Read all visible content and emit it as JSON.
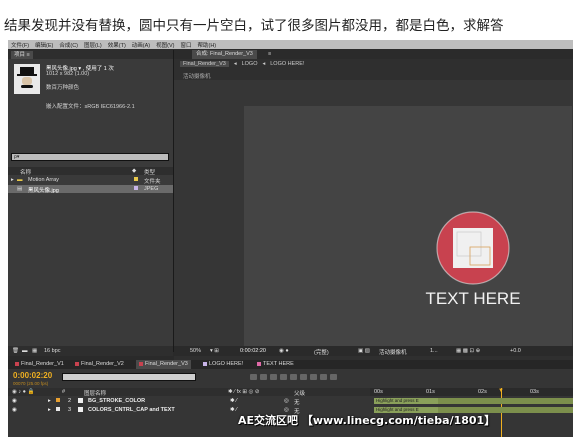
{
  "post": {
    "question": "结果发现并没有替换，圆中只有一片空白，试了很多图片都没用，都是白色，求解答"
  },
  "menubar": {
    "items": [
      "文件(F)",
      "编辑(E)",
      "合成(C)",
      "图层(L)",
      "效果(T)",
      "动画(A)",
      "视图(V)",
      "窗口",
      "帮助(H)"
    ]
  },
  "project": {
    "tab_label": "项目 ≡",
    "file_name": "黑风头像.jpg ▾ , 使用了 1 次",
    "file_size": "1012 x 982 (1.00)",
    "file_colors": "数百万种颜色",
    "color_profile": "嵌入配置文件：sRGB IEC61966-2.1",
    "search_value": "ρ▾",
    "col_name": "名称",
    "col_type": "类型",
    "rows": [
      {
        "name": "Motion Array",
        "type": "文件夹",
        "color": "#e8c84a"
      },
      {
        "name": "黑风头像.jpg",
        "type": "JPEG",
        "color": "#c8b4e8"
      }
    ],
    "bpc": "16 bpc"
  },
  "composition": {
    "tabs": [
      "合成: Final_Render_V3",
      "≡"
    ],
    "breadcrumbs": [
      "Final_Render_V3",
      "LOGO",
      "LOGO HERE!"
    ],
    "renderer_label": "活动摄像机",
    "artwork_text": "TEXT HERE",
    "colors": {
      "circle": "#c8424f",
      "ring": "#e6e6e6",
      "accent": "#d9a25a",
      "canvas": "#444444"
    },
    "footer": {
      "zoom": "50%",
      "timecode": "0:00:02:20",
      "resolution": "(完整)",
      "camera": "活动摄像机",
      "views": "1...",
      "exposure": "+0.0"
    }
  },
  "timeline": {
    "tabs": [
      {
        "label": "Final_Render_V1",
        "color": "#c8424f"
      },
      {
        "label": "Final_Render_V2",
        "color": "#c8424f"
      },
      {
        "label": "Final_Render_V3",
        "color": "#c8424f"
      },
      {
        "label": "LOGO HERE!",
        "color": "#c8b4e8"
      },
      {
        "label": "TEXT HERE",
        "color": "#e06aa8"
      }
    ],
    "timecode": "0:00:02:20",
    "fps": "00070 (25.00 fps)",
    "hdr_num": "#",
    "hdr_name": "图层名称",
    "hdr_parent": "父级",
    "ruler": [
      "00s",
      "01s",
      "02s",
      "03s"
    ],
    "layers": [
      {
        "num": "2",
        "name": "BG_STROKE_COLOR",
        "parent": "无",
        "bar_label": "Highlight and press E",
        "color": "#e8a030"
      },
      {
        "num": "3",
        "name": "COLORS_CNTRL_CAP and TEXT",
        "parent": "无",
        "bar_label": "Highlight and press E",
        "color": "#e8e8e8"
      }
    ],
    "bar_color": "#8aa05a"
  },
  "watermark": "AE交流区吧 【www.linecg.com/tieba/1801】"
}
